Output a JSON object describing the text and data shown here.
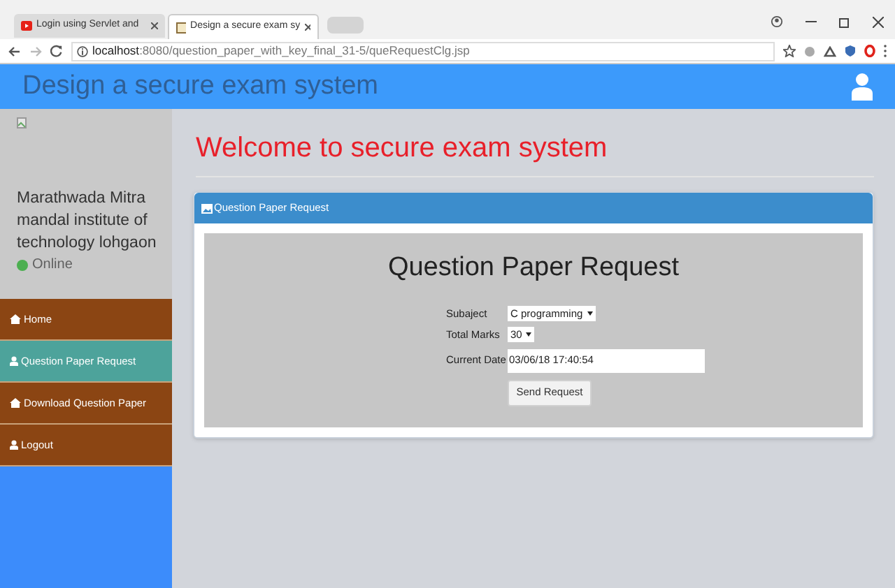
{
  "browser": {
    "tabs": [
      {
        "title": "Login using Servlet and",
        "selected": false
      },
      {
        "title": "Design a secure exam sy",
        "selected": true
      }
    ],
    "url_host": "localhost",
    "url_path": ":8080/question_paper_with_key_final_31-5/queRequestClg.jsp"
  },
  "header": {
    "title": "Design a secure exam system"
  },
  "sidebar": {
    "institute": "Marathwada Mitra mandal institute of technology lohgaon",
    "status": {
      "label": "Online",
      "color": "#4caf50"
    },
    "items": [
      {
        "label": "Home",
        "kind": "home",
        "selected": false
      },
      {
        "label": "Question Paper Request",
        "kind": "user",
        "selected": true
      },
      {
        "label": "Download Question Paper",
        "kind": "home",
        "selected": false
      },
      {
        "label": "Logout",
        "kind": "user",
        "selected": false
      }
    ]
  },
  "main": {
    "welcome": "Welcome to secure exam system",
    "panel_title": "Question Paper Request",
    "form_title": "Question Paper Request",
    "fields": [
      {
        "kind": "select",
        "label": "Subaject",
        "value": "C programming"
      },
      {
        "kind": "select",
        "label": "Total Marks",
        "value": "30"
      },
      {
        "kind": "text",
        "label": "Current Date",
        "value": "03/06/18 17:40:54"
      }
    ],
    "button": "Send Request"
  }
}
